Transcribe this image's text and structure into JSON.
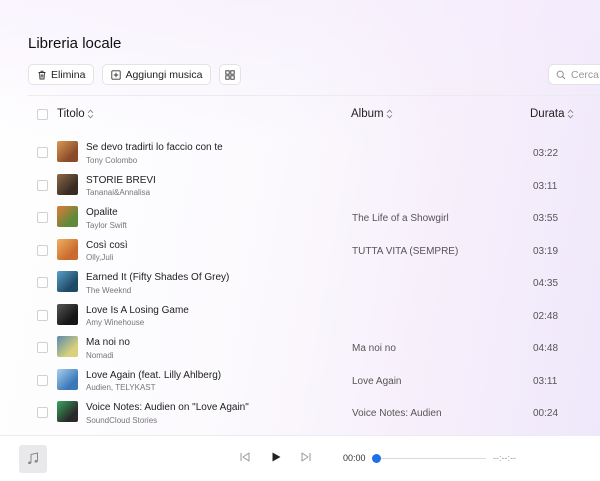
{
  "page": {
    "title": "Libreria locale"
  },
  "toolbar": {
    "delete_label": "Elimina",
    "add_music_label": "Aggiungi musica",
    "view_toggle_icon": "grid-icon",
    "search_placeholder": "Cerca"
  },
  "columns": {
    "title": "Titolo",
    "album": "Album",
    "duration": "Durata"
  },
  "tracks": [
    {
      "title": "Se devo tradirti lo faccio con te",
      "artist": "Tony Colombo",
      "album": "",
      "duration": "03:22",
      "cover_color": "#8a4b2a",
      "cover_accent": "#d99a52"
    },
    {
      "title": "STORIE BREVI",
      "artist": "Tananai&Annalisa",
      "album": "",
      "duration": "03:11",
      "cover_color": "#3a2c22",
      "cover_accent": "#8c6a4a"
    },
    {
      "title": "Opalite",
      "artist": "Taylor Swift",
      "album": "The Life of a Showgirl",
      "duration": "03:55",
      "cover_color": "#5e8a3a",
      "cover_accent": "#e07a3a"
    },
    {
      "title": "Così così",
      "artist": "Olly,Juli",
      "album": "TUTTA VITA (SEMPRE)",
      "duration": "03:19",
      "cover_color": "#c96a2e",
      "cover_accent": "#f0b060"
    },
    {
      "title": "Earned It (Fifty Shades Of Grey)",
      "artist": "The Weeknd",
      "album": "",
      "duration": "04:35",
      "cover_color": "#1f4a66",
      "cover_accent": "#5aa0c8"
    },
    {
      "title": "Love Is A Losing Game",
      "artist": "Amy Winehouse",
      "album": "",
      "duration": "02:48",
      "cover_color": "#151515",
      "cover_accent": "#555555"
    },
    {
      "title": "Ma noi no",
      "artist": "Nomadi",
      "album": "Ma noi no",
      "duration": "04:48",
      "cover_color": "#d8d07a",
      "cover_accent": "#5a8ab0"
    },
    {
      "title": "Love Again (feat. Lilly Ahlberg)",
      "artist": "Audien, TELYKAST",
      "album": "Love Again",
      "duration": "03:11",
      "cover_color": "#3a78b8",
      "cover_accent": "#a8d0f0"
    },
    {
      "title": "Voice Notes: Audien on \"Love Again\"",
      "artist": "SoundCloud Stories",
      "album": "Voice Notes: Audien",
      "duration": "00:24",
      "cover_color": "#2a2a2a",
      "cover_accent": "#3aa860"
    }
  ],
  "player": {
    "current_time": "00:00",
    "total_time": "--:--:--",
    "progress": 0,
    "accent_color": "#1e6fe8"
  }
}
